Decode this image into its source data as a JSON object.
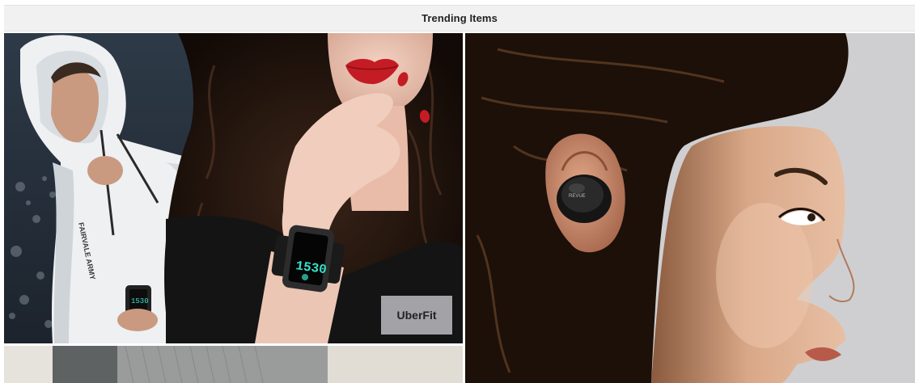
{
  "header": {
    "title": "Trending Items"
  },
  "tiles": [
    {
      "id": "smartwatch",
      "badge": "UberFit",
      "watch_time": "1530",
      "hoodie_print": "FAIRVALE ARMY"
    },
    {
      "id": "earbuds",
      "earbud_brand": "REVUE"
    },
    {
      "id": "partial"
    }
  ],
  "colors": {
    "header_bg": "#f1f1f1",
    "badge_bg": "#aeaeb4",
    "badge_text": "#222222",
    "earbud_bg": "#cfcfd1",
    "watch_screen": "#38e0c8"
  }
}
